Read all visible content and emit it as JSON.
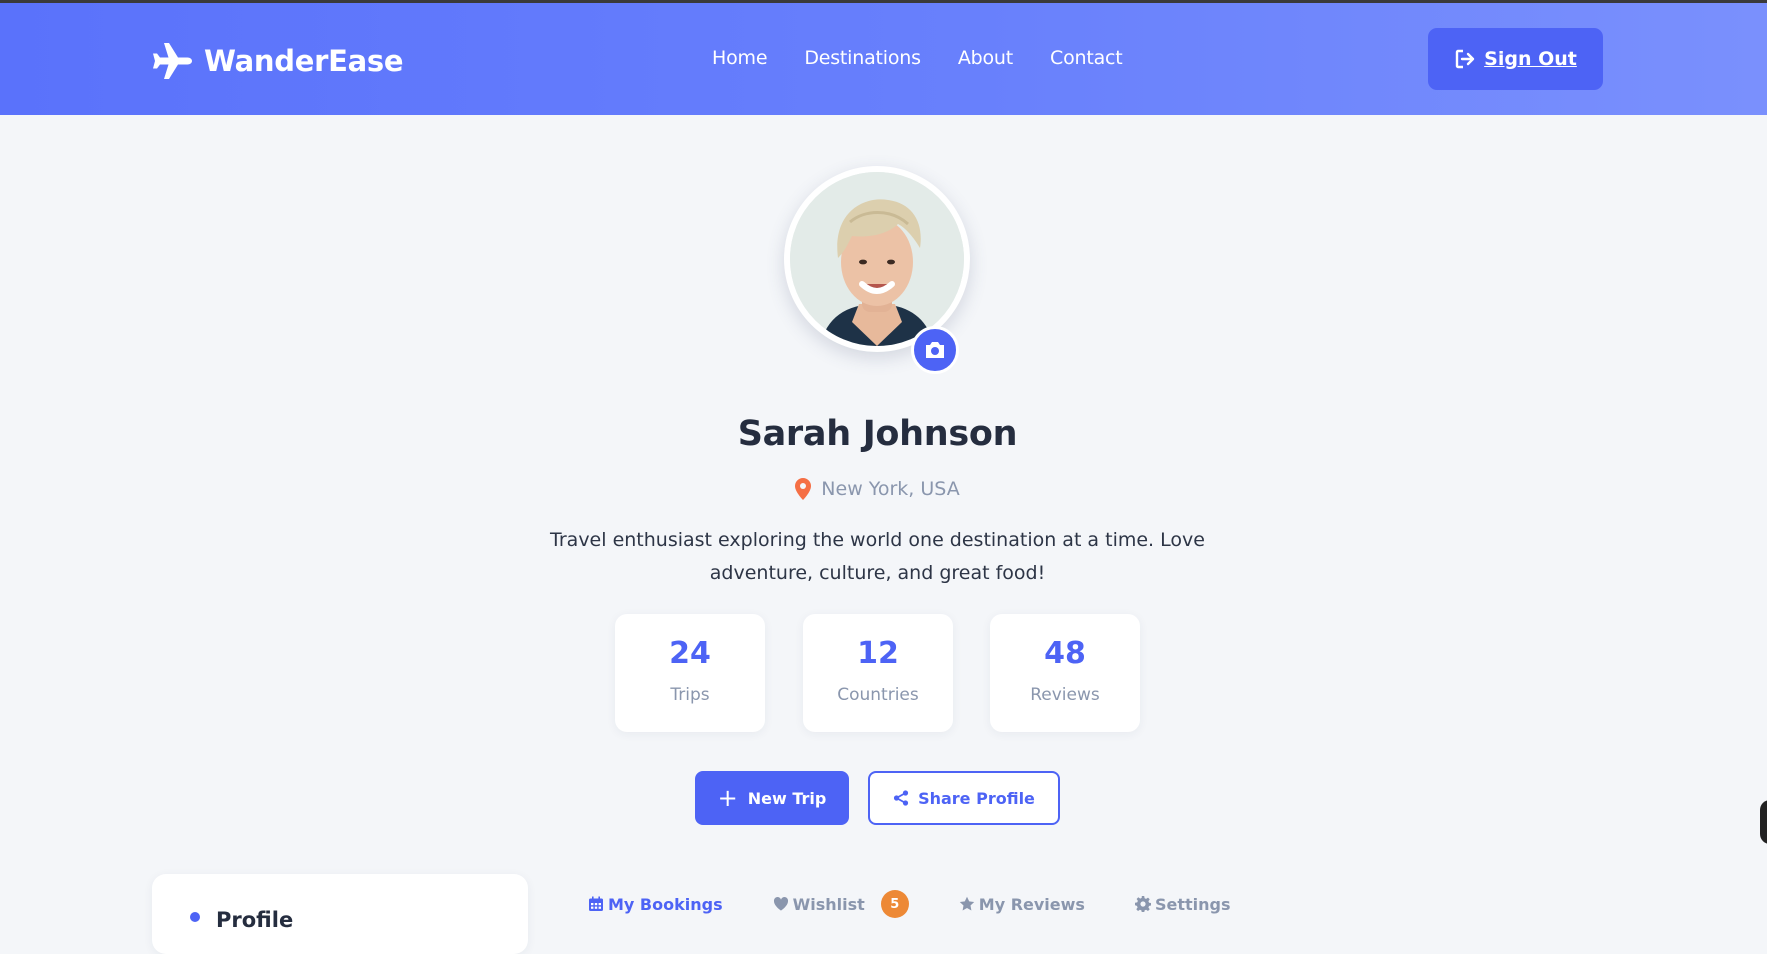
{
  "brand": {
    "name": "WanderEase",
    "icon": "plane-icon"
  },
  "nav": {
    "links": [
      "Home",
      "Destinations",
      "About",
      "Contact"
    ],
    "signout_label": "Sign Out"
  },
  "profile": {
    "name": "Sarah Johnson",
    "location": "New York, USA",
    "bio": "Travel enthusiast exploring the world one destination at a time. Love adventure, culture, and great food!"
  },
  "stats": [
    {
      "value": "24",
      "label": "Trips"
    },
    {
      "value": "12",
      "label": "Countries"
    },
    {
      "value": "48",
      "label": "Reviews"
    }
  ],
  "actions": {
    "new_trip": "New Trip",
    "share_profile": "Share Profile"
  },
  "sidebar": {
    "title": "Profile"
  },
  "tabs": [
    {
      "label": "My Bookings",
      "icon": "calendar-icon",
      "active": true
    },
    {
      "label": "Wishlist",
      "icon": "heart-icon",
      "badge": "5"
    },
    {
      "label": "My Reviews",
      "icon": "star-icon"
    },
    {
      "label": "Settings",
      "icon": "gear-icon"
    }
  ],
  "colors": {
    "primary": "#4d63f5",
    "navbar_start": "#5a72fb",
    "navbar_end": "#7a90fd",
    "muted": "#8a96ad",
    "badge": "#ed8936",
    "location_pin": "#f56f45"
  }
}
